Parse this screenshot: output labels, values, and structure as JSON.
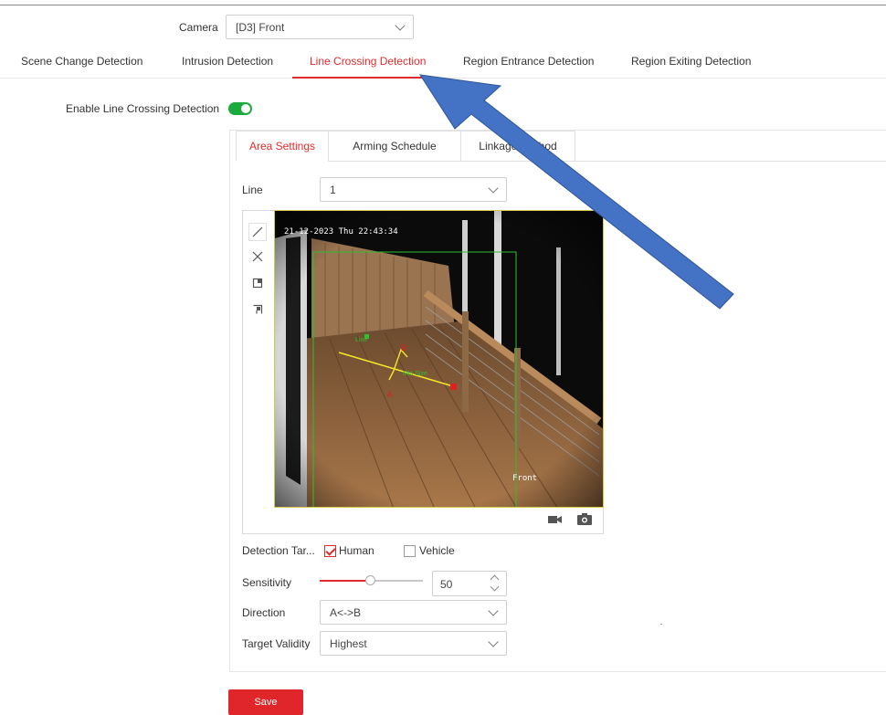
{
  "camera": {
    "label": "Camera",
    "value": "[D3] Front"
  },
  "tabs": [
    {
      "label": "Scene Change Detection",
      "active": false
    },
    {
      "label": "Intrusion Detection",
      "active": false
    },
    {
      "label": "Line Crossing Detection",
      "active": true
    },
    {
      "label": "Region Entrance Detection",
      "active": false
    },
    {
      "label": "Region Exiting Detection",
      "active": false
    }
  ],
  "enable": {
    "label": "Enable Line Crossing Detection",
    "on": true
  },
  "subtabs": [
    {
      "label": "Area Settings",
      "active": true
    },
    {
      "label": "Arming Schedule",
      "active": false
    },
    {
      "label": "Linkage Method",
      "active": false
    }
  ],
  "line": {
    "label": "Line",
    "value": "1"
  },
  "tools": [
    "draw-line-icon",
    "clear-icon",
    "max-size-icon",
    "min-size-icon"
  ],
  "video": {
    "timestamp": "21-12-2023 Thu 22:43:34",
    "camera_name": "Front",
    "point_a": "A",
    "point_b": "B",
    "tag_left": "Line",
    "tag_right": "Min Size"
  },
  "video_icons": [
    "record-icon",
    "snapshot-icon"
  ],
  "detection_target": {
    "label": "Detection Tar...",
    "human_label": "Human",
    "human_checked": true,
    "vehicle_label": "Vehicle",
    "vehicle_checked": false
  },
  "sensitivity": {
    "label": "Sensitivity",
    "value": "50",
    "level": 0.5
  },
  "direction": {
    "label": "Direction",
    "value": "A<->B"
  },
  "target_validity": {
    "label": "Target Validity",
    "value": "Highest"
  },
  "save_label": "Save",
  "colors": {
    "accent": "#e02b2b",
    "toggle": "#1aab3c",
    "arrow": "#4472c4"
  }
}
